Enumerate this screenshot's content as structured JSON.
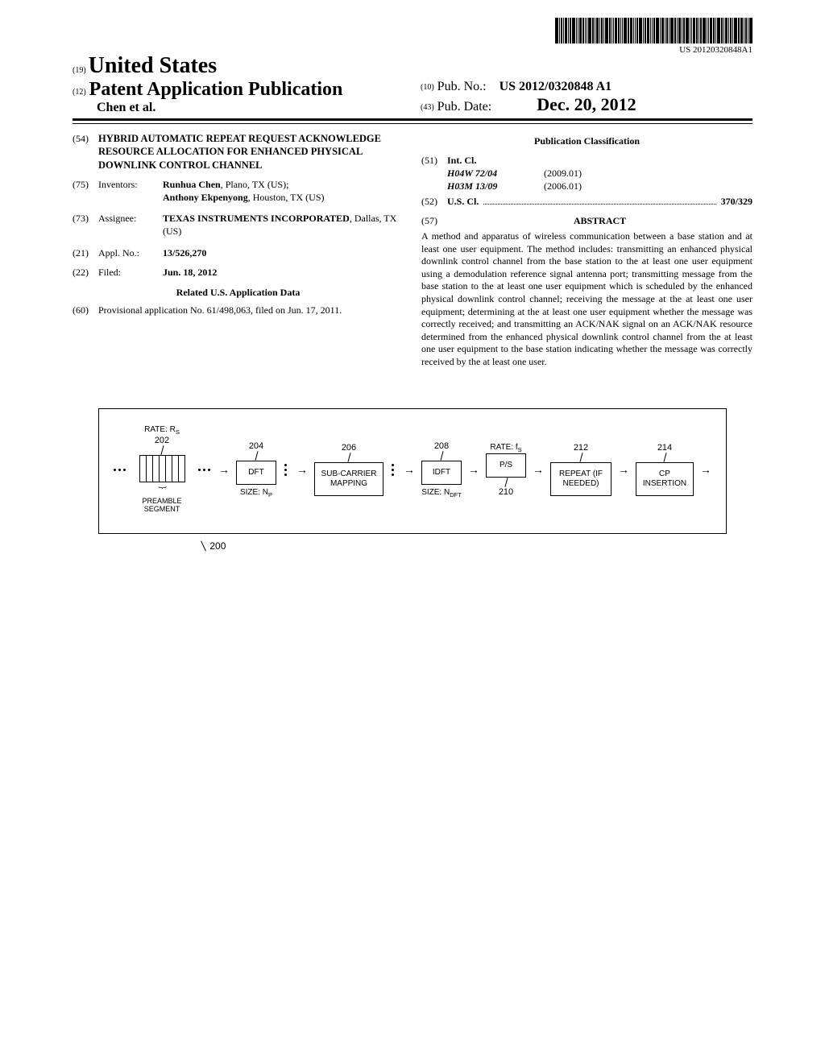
{
  "barcode_number": "US 20120320848A1",
  "header": {
    "inid19": "(19)",
    "country": "United States",
    "inid12": "(12)",
    "pub_type": "Patent Application Publication",
    "authors": "Chen et al.",
    "inid10": "(10)",
    "pubno_label": "Pub. No.:",
    "pubno": "US 2012/0320848 A1",
    "inid43": "(43)",
    "pubdate_label": "Pub. Date:",
    "pubdate": "Dec. 20, 2012"
  },
  "left": {
    "inid54": "(54)",
    "title": "HYBRID AUTOMATIC REPEAT REQUEST ACKNOWLEDGE RESOURCE ALLOCATION FOR ENHANCED PHYSICAL DOWNLINK CONTROL CHANNEL",
    "inid75": "(75)",
    "inventors_label": "Inventors:",
    "inventor1": "Runhua Chen",
    "inventor1_loc": ", Plano, TX (US);",
    "inventor2": "Anthony Ekpenyong",
    "inventor2_loc": ", Houston, TX (US)",
    "inid73": "(73)",
    "assignee_label": "Assignee:",
    "assignee_name": "TEXAS INSTRUMENTS INCORPORATED",
    "assignee_loc": ", Dallas, TX (US)",
    "inid21": "(21)",
    "applno_label": "Appl. No.:",
    "applno": "13/526,270",
    "inid22": "(22)",
    "filed_label": "Filed:",
    "filed": "Jun. 18, 2012",
    "related_hdr": "Related U.S. Application Data",
    "inid60": "(60)",
    "provisional": "Provisional application No. 61/498,063, filed on Jun. 17, 2011."
  },
  "right": {
    "classification_hdr": "Publication Classification",
    "inid51": "(51)",
    "intcl_label": "Int. Cl.",
    "intcl1_code": "H04W 72/04",
    "intcl1_date": "(2009.01)",
    "intcl2_code": "H03M 13/09",
    "intcl2_date": "(2006.01)",
    "inid52": "(52)",
    "uscl_label": "U.S. Cl.",
    "uscl_val": "370/329",
    "inid57": "(57)",
    "abstract_label": "ABSTRACT",
    "abstract": "A method and apparatus of wireless communication between a base station and at least one user equipment. The method includes: transmitting an enhanced physical downlink control channel from the base station to the at least one user equipment using a demodulation reference signal antenna port; transmitting message from the base station to the at least one user equipment which is scheduled by the enhanced physical downlink control channel; receiving the message at the at least one user equipment; determining at the at least one user equipment whether the message was correctly received; and transmitting an ACK/NAK signal on an ACK/NAK resource determined from the enhanced physical downlink control channel from the at least one user equipment to the base station indicating whether the message was correctly received by the at least one user."
  },
  "figure": {
    "ref200": "200",
    "rate_rs": "RATE: R",
    "rate_rs_sub": "S",
    "ref202": "202",
    "preamble_label": "PREAMBLE SEGMENT",
    "ref204": "204",
    "dft": "DFT",
    "size_np": "SIZE: N",
    "size_np_sub": "P",
    "ref206": "206",
    "subcarrier": "SUB-CARRIER MAPPING",
    "ref208": "208",
    "idft": "IDFT",
    "size_ndft": "SIZE: N",
    "size_ndft_sub": "DFT",
    "rate_fs": "RATE: f",
    "rate_fs_sub": "S",
    "ref210": "210",
    "ps": "P/S",
    "ref212": "212",
    "repeat": "REPEAT (IF NEEDED)",
    "ref214": "214",
    "cp": "CP INSERTION"
  }
}
